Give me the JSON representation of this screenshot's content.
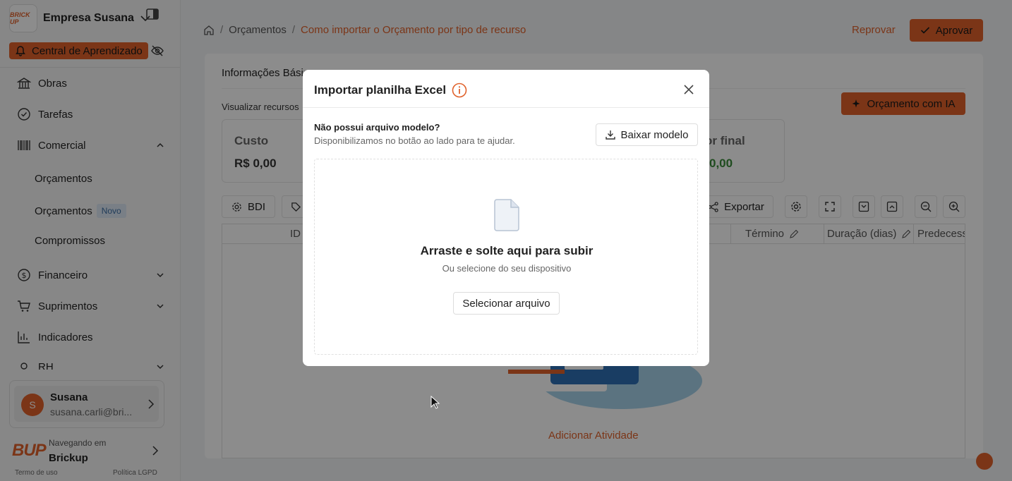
{
  "sidebar": {
    "logo_text": "BRICK UP",
    "company": "Empresa Susana",
    "learning_center": "Central de Aprendizado",
    "nav": [
      {
        "label": "Obras"
      },
      {
        "label": "Tarefas"
      },
      {
        "label": "Comercial"
      },
      {
        "label": "Financeiro"
      },
      {
        "label": "Suprimentos"
      },
      {
        "label": "Indicadores"
      },
      {
        "label": "RH"
      }
    ],
    "sub": [
      {
        "label": "Orçamentos"
      },
      {
        "label": "Orçamentos",
        "badge": "Novo"
      },
      {
        "label": "Compromissos"
      }
    ],
    "user": {
      "initial": "S",
      "name": "Susana",
      "email": "susana.carli@bri..."
    },
    "brand_logo": "BUP",
    "navigating_in": "Navegando em",
    "workspace": "Brickup",
    "footer": {
      "terms": "Termo de uso",
      "privacy": "Política LGPD"
    }
  },
  "header": {
    "breadcrumb": [
      "Orçamentos",
      "Como importar o Orçamento por tipo de recurso"
    ],
    "reject": "Reprovar",
    "approve": "Aprovar"
  },
  "main": {
    "tab_basic": "Informações Básic",
    "view_resources": "Visualizar recursos",
    "ai_button": "Orçamento com IA",
    "stats": {
      "cost_label": "Custo",
      "cost_value": "R$ 0,00",
      "final_label": "or final",
      "final_value": "0,00"
    },
    "toolbar": {
      "bdi": "BDI",
      "export": "Exportar"
    },
    "columns": {
      "id": "ID",
      "end": "Término",
      "duration": "Duração (dias)",
      "pred": "Predecess"
    },
    "add_activity": "Adicionar Atividade"
  },
  "modal": {
    "title": "Importar planilha Excel",
    "no_model": "Não possui arquivo modelo?",
    "no_model_sub": "Disponibilizamos no botão ao lado para te ajudar.",
    "download": "Baixar modelo",
    "drop_title": "Arraste e solte aqui para subir",
    "drop_sub": "Ou selecione do seu dispositivo",
    "select": "Selecionar arquivo"
  },
  "colors": {
    "accent": "#e0612a"
  }
}
